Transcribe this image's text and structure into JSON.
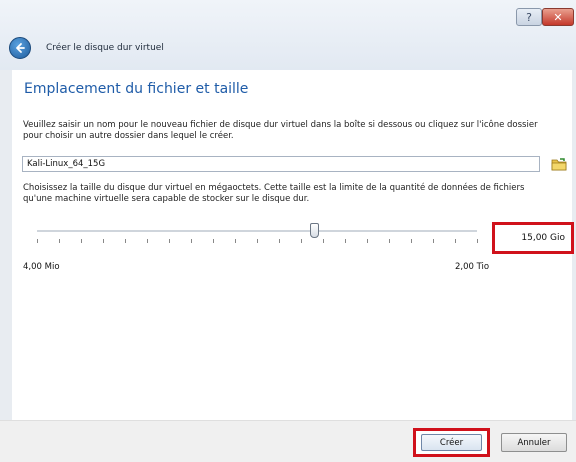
{
  "window": {
    "title": "Créer le disque dur virtuel",
    "help_label": "?",
    "close_label": "✕"
  },
  "page": {
    "heading": "Emplacement du fichier et taille",
    "location_description": "Veuillez saisir un nom pour le nouveau fichier de disque dur virtuel dans la boîte si dessous ou cliquez sur l'icône dossier pour choisir un autre dossier dans lequel le créer.",
    "file_name_value": "Kali-Linux_64_15G",
    "size_description": "Choisissez la taille du disque dur virtuel en mégaoctets. Cette taille est la limite de la quantité de données de fichiers qu'une machine virtuelle sera capable de stocker sur le disque dur.",
    "size_value": "15,00 Gio",
    "slider_min_label": "4,00 Mio",
    "slider_max_label": "2,00 Tio",
    "slider_position_fraction": 0.63
  },
  "buttons": {
    "create": "Créer",
    "cancel": "Annuler"
  },
  "icons": {
    "back": "back-arrow-icon",
    "folder": "folder-icon"
  },
  "colors": {
    "heading": "#1f5ca8",
    "highlight": "#d0111b"
  }
}
